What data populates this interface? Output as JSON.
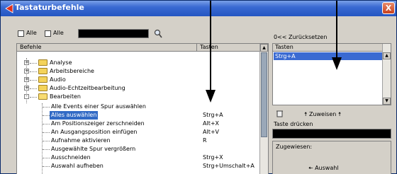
{
  "window": {
    "title": "Tastaturbefehle",
    "close_label": "X"
  },
  "search": {
    "check1_label": "Alle",
    "check2_label": "Alle",
    "value": ""
  },
  "reset_label": "0<< Zurücksetzen",
  "tree": {
    "col_commands": "Befehle",
    "col_keys": "Tasten",
    "categories": [
      {
        "label": "Analyse",
        "expand": "+"
      },
      {
        "label": "Arbeitsbereiche",
        "expand": "+"
      },
      {
        "label": "Audio",
        "expand": "+"
      },
      {
        "label": "Audio-Echtzeitbearbeitung",
        "expand": "+"
      },
      {
        "label": "Bearbeiten",
        "expand": "-"
      }
    ],
    "commands": [
      {
        "label": "Alle Events einer Spur auswählen",
        "key": ""
      },
      {
        "label": "Alles auswählen",
        "key": "Strg+A"
      },
      {
        "label": "Am Positionszeiger zerschneiden",
        "key": "Alt+X"
      },
      {
        "label": "An Ausgangsposition einfügen",
        "key": "Alt+V"
      },
      {
        "label": "Aufnahme aktivieren",
        "key": "R"
      },
      {
        "label": "Ausgewählte Spur vergrößern",
        "key": ""
      },
      {
        "label": "Ausschneiden",
        "key": "Strg+X"
      },
      {
        "label": "Auswahl aufheben",
        "key": "Strg+Umschalt+A"
      }
    ]
  },
  "keys_panel": {
    "header": "Tasten",
    "items": [
      "Strg+A"
    ]
  },
  "assign_label": "Zuweisen",
  "press_key_label": "Taste drücken",
  "press_key_value": "",
  "assigned_label": "Zugewiesen:",
  "choose_label": "Auswahl",
  "colors": {
    "title_bar": "#2456c2",
    "selection": "#316ac5",
    "folder": "#f4d35a",
    "panel": "#d4d0c8"
  }
}
